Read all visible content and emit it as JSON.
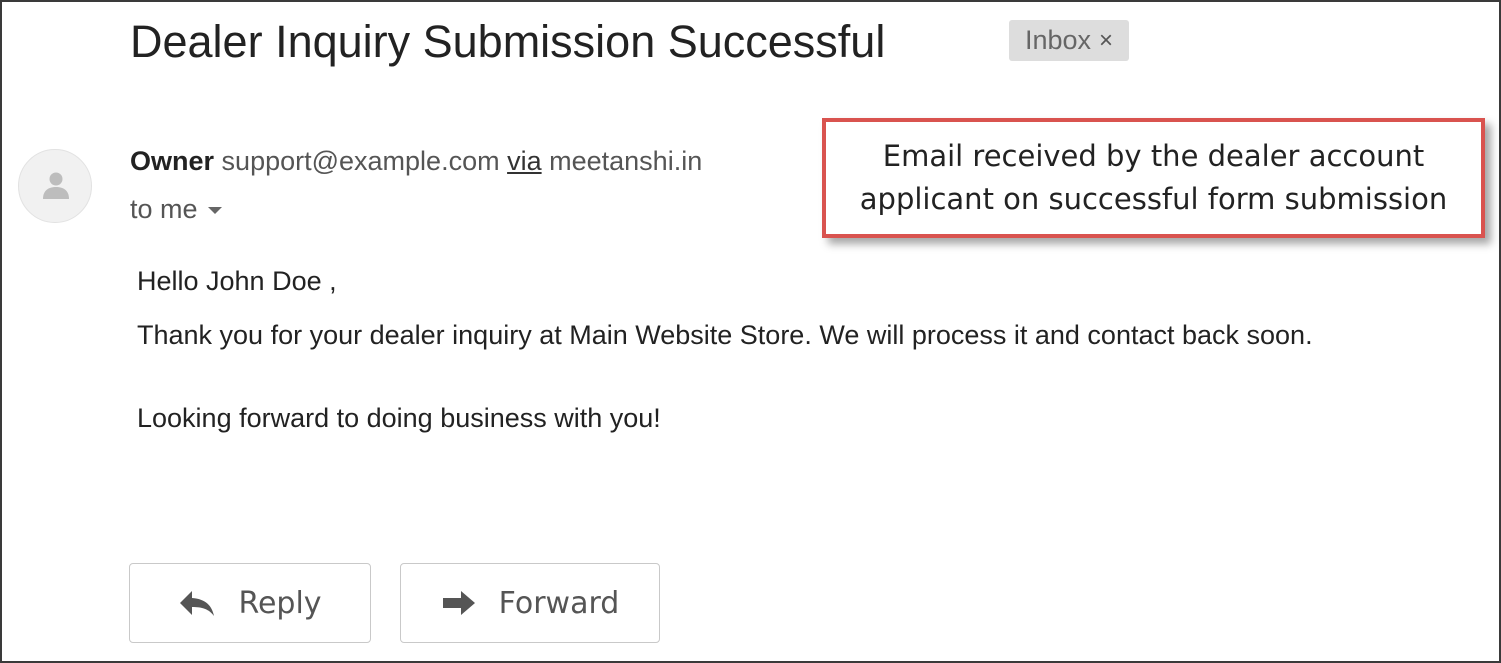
{
  "email": {
    "subject": "Dealer Inquiry Submission Successful",
    "label_chip": "Inbox",
    "label_chip_close": "×",
    "sender": {
      "name": "Owner",
      "email": "support@example.com",
      "via_word": "via",
      "via_domain": "meetanshi.in"
    },
    "recipient": "to me",
    "body": {
      "greeting": "Hello John Doe ,",
      "line1": "Thank you for your dealer inquiry at Main Website Store. We will process it and contact back soon.",
      "line2": "Looking forward to doing business with you!"
    }
  },
  "annotation": {
    "line1": "Email received by the dealer account",
    "line2": "applicant on successful form submission",
    "border_color": "#d9534f"
  },
  "actions": {
    "reply_label": "Reply",
    "forward_label": "Forward",
    "reply_icon": "reply-arrow-icon",
    "forward_icon": "forward-arrow-icon"
  }
}
